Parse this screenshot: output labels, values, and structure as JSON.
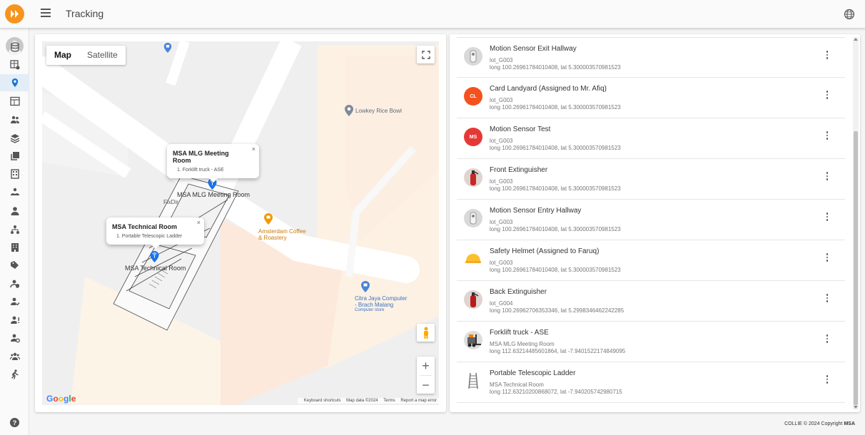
{
  "header": {
    "title": "Tracking"
  },
  "colors": {
    "accent": "#1976d2",
    "logo": "#f7941d"
  },
  "sidebar": {
    "items": [
      {
        "icon": "database-icon",
        "active": false
      },
      {
        "icon": "dashboard-table-icon",
        "active": false
      },
      {
        "icon": "location-pin-icon",
        "active": true
      },
      {
        "icon": "table-chart-icon",
        "active": false
      },
      {
        "icon": "people-icon",
        "active": false
      },
      {
        "icon": "stack-icon",
        "active": false
      },
      {
        "icon": "library-icon",
        "active": false
      },
      {
        "icon": "building-icon",
        "active": false
      },
      {
        "icon": "hands-icon",
        "active": false
      },
      {
        "icon": "person-icon",
        "active": false
      },
      {
        "icon": "hierarchy-icon",
        "active": false
      },
      {
        "icon": "apartment-icon",
        "active": false
      },
      {
        "icon": "tags-icon",
        "active": false
      },
      {
        "icon": "person-shield-icon",
        "active": false
      },
      {
        "icon": "person-check-icon",
        "active": false
      },
      {
        "icon": "person-alert-icon",
        "active": false
      },
      {
        "icon": "person-gear-icon",
        "active": false
      },
      {
        "icon": "group-icon",
        "active": false
      },
      {
        "icon": "walking-person-icon",
        "active": false
      }
    ]
  },
  "map": {
    "type_map": "Map",
    "type_satellite": "Satellite",
    "poi": {
      "lowkey": "Lowkey Rice Bowl",
      "amsterdam_1": "Amsterdam Coffee",
      "amsterdam_2": "& Roastery",
      "citra_1": "Citra Jaya Computer",
      "citra_2": "- Brach Malang",
      "citra_3": "Computer store",
      "fixdir": "FixDir",
      "room_mlg": "MSA MLG Meeting Room",
      "room_tech": "MSA Technical Room"
    },
    "infowindows": [
      {
        "title": "MSA MLG Meeting Room",
        "line": "1.  Forklift truck - ASE"
      },
      {
        "title": "MSA Technical Room",
        "line": "1.  Portable Telescopic Ladder"
      }
    ],
    "close_glyph": "×",
    "google": "Google",
    "footer": {
      "shortcuts": "Keyboard shortcuts",
      "mapdata": "Map data ©2024",
      "terms": "Terms",
      "report": "Report a map error"
    },
    "zoom_in": "+",
    "zoom_out": "−"
  },
  "devices": [
    {
      "name": "Motion Sensor Exit Hallway",
      "sub1": "lot_G003",
      "sub2": "long 100.26961784010408, lat 5.300003570981523",
      "avatar": "sensor",
      "initials": "",
      "color": "#9e9e9e"
    },
    {
      "name": "Card Landyard (Assigned to Mr. Afiq)",
      "sub1": "lot_G003",
      "sub2": "long 100.26961784010408, lat 5.300003570981523",
      "avatar": "initials",
      "initials": "CL",
      "color": "#f4511e"
    },
    {
      "name": "Motion Sensor Test",
      "sub1": "lot_G003",
      "sub2": "long 100.26961784010408, lat 5.300003570981523",
      "avatar": "initials",
      "initials": "MS",
      "color": "#e53935"
    },
    {
      "name": "Front Extinguisher",
      "sub1": "lot_G003",
      "sub2": "long 100.26961784010408, lat 5.300003570981523",
      "avatar": "extinguisher",
      "initials": "",
      "color": "#c62828"
    },
    {
      "name": "Motion Sensor Entry Hallway",
      "sub1": "lot_G003",
      "sub2": "long 100.26961784010408, lat 5.300003570981523",
      "avatar": "sensor",
      "initials": "",
      "color": "#9e9e9e"
    },
    {
      "name": "Safety Helmet (Assigned to Faruq)",
      "sub1": "lot_G003",
      "sub2": "long 100.26961784010408, lat 5.300003570981523",
      "avatar": "helmet",
      "initials": "",
      "color": "#fbc02d"
    },
    {
      "name": "Back Extinguisher",
      "sub1": "lot_G004",
      "sub2": "long 100.26962706353346, lat 5.2998346462242285",
      "avatar": "extinguisher",
      "initials": "",
      "color": "#b71c1c"
    },
    {
      "name": "Forklift truck - ASE",
      "sub1": "MSA MLG Meeting Room",
      "sub2": "long 112.63214485601864, lat -7.9401522174849095",
      "avatar": "forklift",
      "initials": "",
      "color": "#616161"
    },
    {
      "name": "Portable Telescopic Ladder",
      "sub1": "MSA Technical Room",
      "sub2": "long 112.63210200868072, lat -7.940205742980715",
      "avatar": "ladder",
      "initials": "",
      "color": "#757575"
    }
  ],
  "footer": {
    "text": "COLLIE © 2024 Copyright ",
    "brand": "MSA"
  }
}
